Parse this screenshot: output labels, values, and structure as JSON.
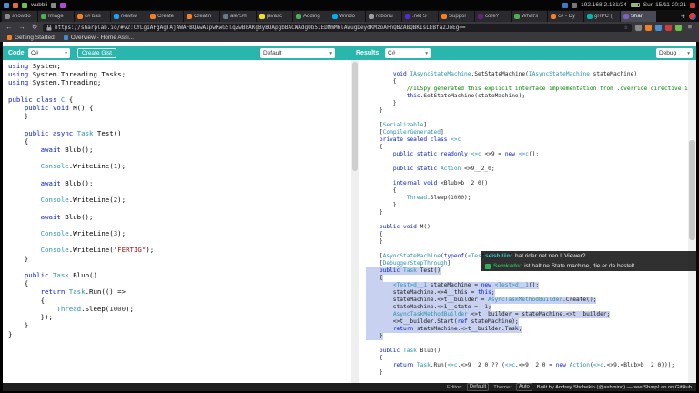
{
  "icons": {
    "back": "←",
    "forward": "→",
    "reload": "↻",
    "menu": "≡",
    "star": "☆",
    "plus": "+",
    "caret": "▾"
  },
  "system_bar": {
    "workspace": "wubbli",
    "network": "192.168.2.131/24",
    "clock": "Sun 15/11 20:21"
  },
  "browser": {
    "tabs": [
      {
        "label": "showdo",
        "favicon_color": "#8a8a8a"
      },
      {
        "label": "Image",
        "favicon_color": "#4caf50"
      },
      {
        "label": "c# bas",
        "favicon_color": "#f48024"
      },
      {
        "label": "newtw",
        "favicon_color": "#1da1f2"
      },
      {
        "label": "Create",
        "favicon_color": "#f48024"
      },
      {
        "label": "Creatin",
        "favicon_color": "#f48024"
      },
      {
        "label": "alerS®",
        "favicon_color": "#607d8b"
      },
      {
        "label": "javasc",
        "favicon_color": "#f7df1e"
      },
      {
        "label": "Adding",
        "favicon_color": "#4caf50"
      },
      {
        "label": "Windo",
        "favicon_color": "#00adef"
      },
      {
        "label": "robonu",
        "favicon_color": "#9e9e9e"
      },
      {
        "label": ".net S",
        "favicon_color": "#512bd4"
      },
      {
        "label": "Suppor",
        "favicon_color": "#f48024"
      },
      {
        "label": "core?",
        "favicon_color": "#68217a"
      },
      {
        "label": "What's",
        "favicon_color": "#4caf50"
      },
      {
        "label": "c# - Dy",
        "favicon_color": "#f48024"
      },
      {
        "label": "gRPC (",
        "favicon_color": "#00b5ad"
      },
      {
        "label": "Shar",
        "favicon_color": "#7b61c4",
        "active": true
      }
    ],
    "url": "https://sharplab.io/#v2:CYLg1AFgAgTAjAWAFBQAwAIpwKwG5lqZwB0AKgByBOApgbBACWAdgOb5IEDMmM6lAwugDeydKMzoAFnQBZABQBKIsLEBfa2JoEg==",
    "bookmarks": [
      {
        "label": "Getting Started",
        "color": "#f48024"
      },
      {
        "label": "Overview - Home Assi...",
        "color": "#3f8cd5"
      }
    ]
  },
  "sharplab": {
    "code_label": "Code",
    "code_language": "C#",
    "create_gist": "Create Gist",
    "branch": "Default",
    "results_label": "Results",
    "results_language": "C#",
    "mode": "Debug",
    "footer": {
      "editor_label": "Editor:",
      "editor_value": "Default",
      "theme_label": "Theme:",
      "theme_value": "Auto",
      "credits": "Built by Andrey Shchekin (@ashmind) — see SharpLab on GitHub"
    }
  },
  "code_left": {
    "lines": [
      [
        [
          "k",
          "using"
        ],
        [
          "p",
          " System;"
        ]
      ],
      [
        [
          "k",
          "using"
        ],
        [
          "p",
          " System.Threading.Tasks;"
        ]
      ],
      [
        [
          "k",
          "using"
        ],
        [
          "p",
          " System.Threading;"
        ]
      ],
      [],
      [
        [
          "k",
          "public"
        ],
        [
          "p",
          " "
        ],
        [
          "k",
          "class"
        ],
        [
          "p",
          " "
        ],
        [
          "t",
          "C"
        ],
        [
          "p",
          " {"
        ]
      ],
      [
        [
          "p",
          "    "
        ],
        [
          "k",
          "public"
        ],
        [
          "p",
          " "
        ],
        [
          "k",
          "void"
        ],
        [
          "p",
          " M() {"
        ]
      ],
      [
        [
          "p",
          "    }"
        ]
      ],
      [],
      [
        [
          "p",
          "    "
        ],
        [
          "k",
          "public"
        ],
        [
          "p",
          " "
        ],
        [
          "k",
          "async"
        ],
        [
          "p",
          " "
        ],
        [
          "t",
          "Task"
        ],
        [
          "p",
          " Test()"
        ]
      ],
      [
        [
          "p",
          "    {"
        ]
      ],
      [
        [
          "p",
          "        "
        ],
        [
          "k",
          "await"
        ],
        [
          "p",
          " Blub();"
        ]
      ],
      [],
      [
        [
          "p",
          "        "
        ],
        [
          "t",
          "Console"
        ],
        [
          "p",
          ".WriteLine("
        ],
        [
          "n",
          "1"
        ],
        [
          "p",
          ");"
        ]
      ],
      [],
      [
        [
          "p",
          "        "
        ],
        [
          "k",
          "await"
        ],
        [
          "p",
          " Blub();"
        ]
      ],
      [],
      [
        [
          "p",
          "        "
        ],
        [
          "t",
          "Console"
        ],
        [
          "p",
          ".WriteLine("
        ],
        [
          "n",
          "2"
        ],
        [
          "p",
          ");"
        ]
      ],
      [],
      [
        [
          "p",
          "        "
        ],
        [
          "k",
          "await"
        ],
        [
          "p",
          " Blub();"
        ]
      ],
      [],
      [
        [
          "p",
          "        "
        ],
        [
          "t",
          "Console"
        ],
        [
          "p",
          ".WriteLine("
        ],
        [
          "n",
          "3"
        ],
        [
          "p",
          ");"
        ]
      ],
      [],
      [
        [
          "p",
          "        "
        ],
        [
          "t",
          "Console"
        ],
        [
          "p",
          ".WriteLine("
        ],
        [
          "s",
          "\"FERTIG\""
        ],
        [
          "p",
          ");"
        ]
      ],
      [
        [
          "p",
          "    }"
        ]
      ],
      [],
      [
        [
          "p",
          "    "
        ],
        [
          "k",
          "public"
        ],
        [
          "p",
          " "
        ],
        [
          "t",
          "Task"
        ],
        [
          "p",
          " Blub()"
        ]
      ],
      [
        [
          "p",
          "    {"
        ]
      ],
      [
        [
          "p",
          "        "
        ],
        [
          "k",
          "return"
        ],
        [
          "p",
          " "
        ],
        [
          "t",
          "Task"
        ],
        [
          "p",
          ".Run(() =>"
        ]
      ],
      [
        [
          "p",
          "        {"
        ]
      ],
      [
        [
          "p",
          "            "
        ],
        [
          "t",
          "Thread"
        ],
        [
          "p",
          ".Sleep("
        ],
        [
          "n",
          "1000"
        ],
        [
          "p",
          ");"
        ]
      ],
      [
        [
          "p",
          "        });"
        ]
      ],
      [
        [
          "p",
          "    }"
        ]
      ],
      [
        [
          "p",
          "}"
        ]
      ]
    ]
  },
  "code_right": {
    "highlight_start": 27,
    "highlight_end": 36,
    "lines": [
      [
        [
          "p",
          "        "
        ],
        [
          "k",
          "void"
        ],
        [
          "p",
          " "
        ],
        [
          "t",
          "IAsyncStateMachine"
        ],
        [
          "p",
          ".SetStateMachine("
        ],
        [
          "t",
          "IAsyncStateMachine"
        ],
        [
          "p",
          " stateMachine)"
        ]
      ],
      [
        [
          "p",
          "        {"
        ]
      ],
      [
        [
          "p",
          "            "
        ],
        [
          "c",
          "//ILSpy generated this explicit interface implementation from .override directive in S"
        ]
      ],
      [
        [
          "p",
          "            "
        ],
        [
          "k",
          "this"
        ],
        [
          "p",
          ".SetStateMachine(stateMachine);"
        ]
      ],
      [
        [
          "p",
          "        }"
        ]
      ],
      [
        [
          "p",
          "    }"
        ]
      ],
      [],
      [
        [
          "p",
          "    ["
        ],
        [
          "t",
          "Serializable"
        ],
        [
          "p",
          "]"
        ]
      ],
      [
        [
          "p",
          "    ["
        ],
        [
          "t",
          "CompilerGenerated"
        ],
        [
          "p",
          "]"
        ]
      ],
      [
        [
          "p",
          "    "
        ],
        [
          "k",
          "private"
        ],
        [
          "p",
          " "
        ],
        [
          "k",
          "sealed"
        ],
        [
          "p",
          " "
        ],
        [
          "k",
          "class"
        ],
        [
          "p",
          " "
        ],
        [
          "t",
          "<>c"
        ]
      ],
      [
        [
          "p",
          "    {"
        ]
      ],
      [
        [
          "p",
          "        "
        ],
        [
          "k",
          "public"
        ],
        [
          "p",
          " "
        ],
        [
          "k",
          "static"
        ],
        [
          "p",
          " "
        ],
        [
          "k",
          "readonly"
        ],
        [
          "p",
          " "
        ],
        [
          "t",
          "<>c"
        ],
        [
          "p",
          " <>9 = "
        ],
        [
          "k",
          "new"
        ],
        [
          "p",
          " "
        ],
        [
          "t",
          "<>c"
        ],
        [
          "p",
          "();"
        ]
      ],
      [],
      [
        [
          "p",
          "        "
        ],
        [
          "k",
          "public"
        ],
        [
          "p",
          " "
        ],
        [
          "k",
          "static"
        ],
        [
          "p",
          " "
        ],
        [
          "t",
          "Action"
        ],
        [
          "p",
          " <>9__2_0;"
        ]
      ],
      [],
      [
        [
          "p",
          "        "
        ],
        [
          "k",
          "internal"
        ],
        [
          "p",
          " "
        ],
        [
          "k",
          "void"
        ],
        [
          "p",
          " <Blub>b__2_0()"
        ]
      ],
      [
        [
          "p",
          "        {"
        ]
      ],
      [
        [
          "p",
          "            "
        ],
        [
          "t",
          "Thread"
        ],
        [
          "p",
          ".Sleep("
        ],
        [
          "n",
          "1000"
        ],
        [
          "p",
          ");"
        ]
      ],
      [
        [
          "p",
          "        }"
        ]
      ],
      [
        [
          "p",
          "    }"
        ]
      ],
      [],
      [
        [
          "p",
          "    "
        ],
        [
          "k",
          "public"
        ],
        [
          "p",
          " "
        ],
        [
          "k",
          "void"
        ],
        [
          "p",
          " M()"
        ]
      ],
      [
        [
          "p",
          "    {"
        ]
      ],
      [
        [
          "p",
          "    }"
        ]
      ],
      [],
      [
        [
          "p",
          "    ["
        ],
        [
          "t",
          "AsyncStateMachine"
        ],
        [
          "p",
          "("
        ],
        [
          "k",
          "typeof"
        ],
        [
          "p",
          "("
        ],
        [
          "t",
          "<Test>d__1"
        ],
        [
          "p",
          "))]"
        ]
      ],
      [
        [
          "p",
          "    ["
        ],
        [
          "t",
          "DebuggerStepThrough"
        ],
        [
          "p",
          "]"
        ]
      ],
      [
        [
          "p",
          "    "
        ],
        [
          "k",
          "public"
        ],
        [
          "p",
          " "
        ],
        [
          "t",
          "Task"
        ],
        [
          "p",
          " Test()"
        ]
      ],
      [
        [
          "p",
          "    {"
        ]
      ],
      [
        [
          "p",
          "        "
        ],
        [
          "t",
          "<Test>d__1"
        ],
        [
          "p",
          " stateMachine = "
        ],
        [
          "k",
          "new"
        ],
        [
          "p",
          " "
        ],
        [
          "t",
          "<Test>d__1"
        ],
        [
          "p",
          "();"
        ]
      ],
      [
        [
          "p",
          "        stateMachine.<>4__this = "
        ],
        [
          "k",
          "this"
        ],
        [
          "p",
          ";"
        ]
      ],
      [
        [
          "p",
          "        stateMachine.<>t__builder = "
        ],
        [
          "t",
          "AsyncTaskMethodBuilder"
        ],
        [
          "p",
          ".Create();"
        ]
      ],
      [
        [
          "p",
          "        stateMachine.<>1__state = -"
        ],
        [
          "n",
          "1"
        ],
        [
          "p",
          ";"
        ]
      ],
      [
        [
          "p",
          "        "
        ],
        [
          "t",
          "AsyncTaskMethodBuilder"
        ],
        [
          "p",
          " <>t__builder = stateMachine.<>t__builder;"
        ]
      ],
      [
        [
          "p",
          "        <>t__builder.Start("
        ],
        [
          "k",
          "ref"
        ],
        [
          "p",
          " stateMachine);"
        ]
      ],
      [
        [
          "p",
          "        "
        ],
        [
          "k",
          "return"
        ],
        [
          "p",
          " stateMachine.<>t__builder.Task;"
        ]
      ],
      [
        [
          "p",
          "    }"
        ]
      ],
      [],
      [
        [
          "p",
          "    "
        ],
        [
          "k",
          "public"
        ],
        [
          "p",
          " "
        ],
        [
          "t",
          "Task"
        ],
        [
          "p",
          " Blub()"
        ]
      ],
      [
        [
          "p",
          "    {"
        ]
      ],
      [
        [
          "p",
          "        "
        ],
        [
          "k",
          "return"
        ],
        [
          "p",
          " "
        ],
        [
          "t",
          "Task"
        ],
        [
          "p",
          ".Run("
        ],
        [
          "t",
          "<>c"
        ],
        [
          "p",
          ".<>9__2_0 ?? ("
        ],
        [
          "t",
          "<>c"
        ],
        [
          "p",
          ".<>9__2_0 = "
        ],
        [
          "k",
          "new"
        ],
        [
          "p",
          " "
        ],
        [
          "t",
          "Action"
        ],
        [
          "p",
          "("
        ],
        [
          "t",
          "<>c"
        ],
        [
          "p",
          ".<>9.<Blub>b__2_0)));"
        ]
      ],
      [
        [
          "p",
          "    }"
        ]
      ]
    ]
  },
  "chat": {
    "messages": [
      {
        "user": "seishiliin",
        "text": "hat rider net nen ILViewer?",
        "user_color": "#3ec6d0"
      },
      {
        "user": "Semkado",
        "text": "ist halt ne State machine, die er da bastelt...",
        "user_color": "#2faf60",
        "badge_color": "#2faf60"
      }
    ]
  }
}
